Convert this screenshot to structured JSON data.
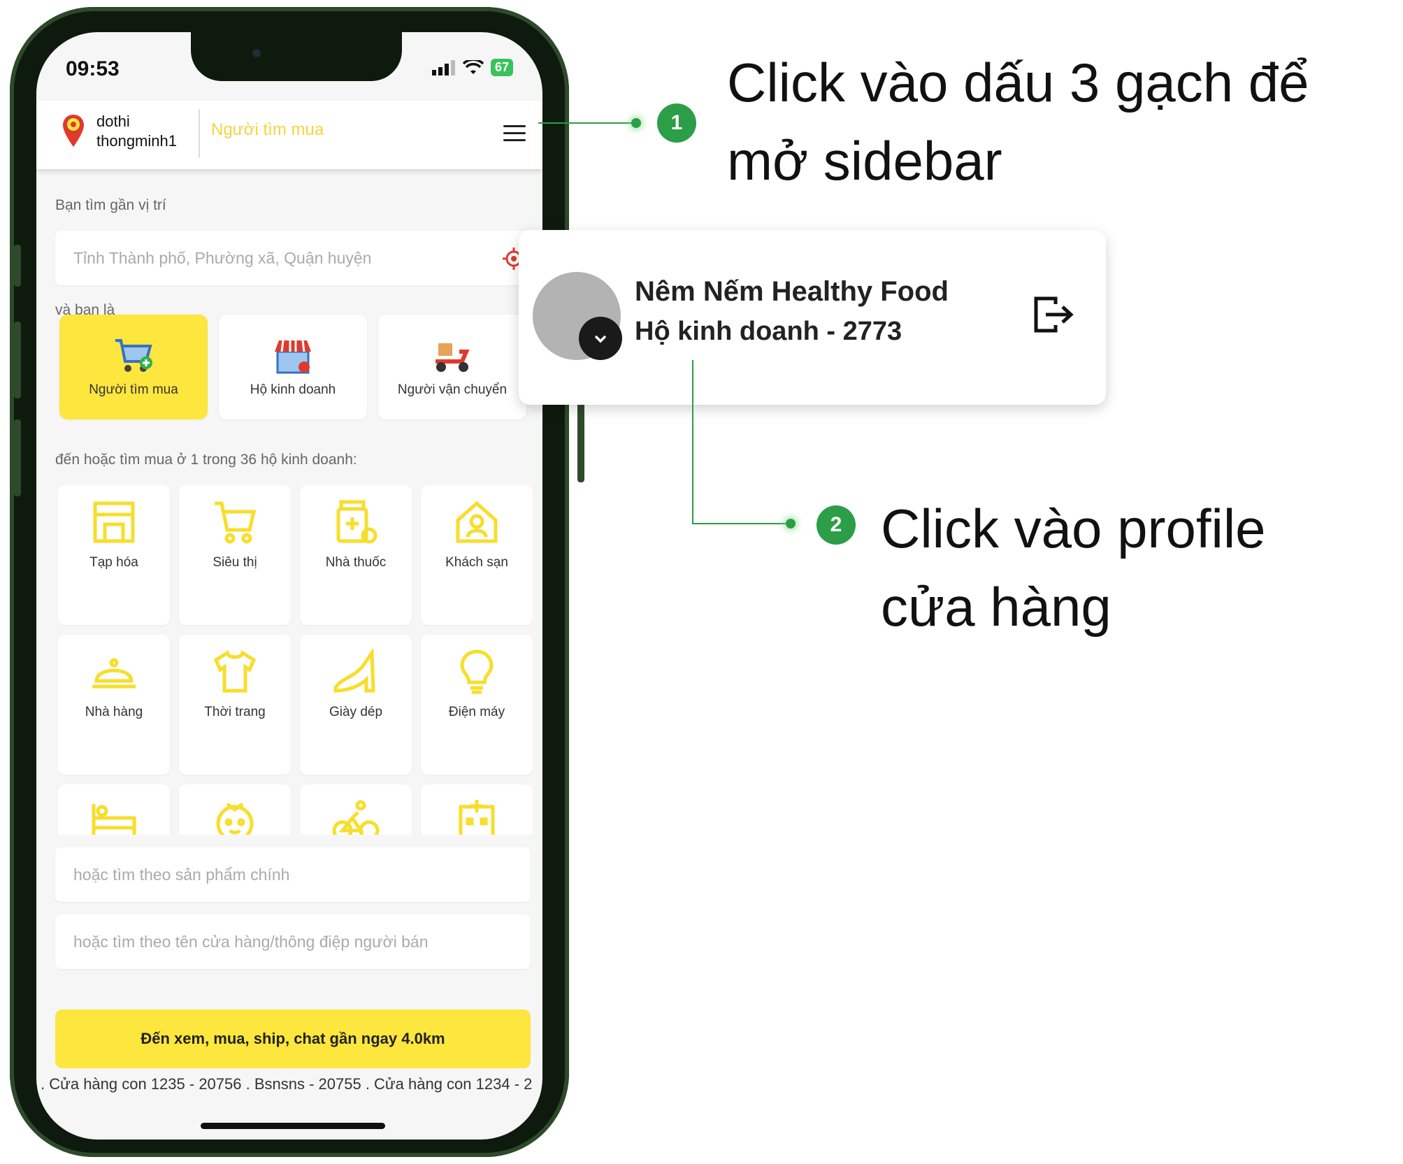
{
  "status_bar": {
    "time": "09:53",
    "battery": "67"
  },
  "header": {
    "brand_line1": "dothi",
    "brand_line2": "thongminh1",
    "role": "Người tìm mua"
  },
  "location": {
    "label": "Bạn tìm gần vị trí",
    "placeholder": "Tỉnh Thành phố, Phường xã, Quận huyện"
  },
  "role_section": {
    "label": "và bạn là",
    "roles": [
      {
        "label": "Người tìm mua",
        "active": true
      },
      {
        "label": "Hộ kinh doanh",
        "active": false
      },
      {
        "label": "Người vận chuyển",
        "active": false
      }
    ]
  },
  "categories_label": "đến hoặc tìm mua ở 1 trong 36 hộ kinh doanh:",
  "categories": [
    {
      "label": "Tạp hóa",
      "icon": "store-icon"
    },
    {
      "label": "Siêu thị",
      "icon": "cart-icon"
    },
    {
      "label": "Nhà thuốc",
      "icon": "pharmacy-icon"
    },
    {
      "label": "Khách sạn",
      "icon": "hotel-icon"
    },
    {
      "label": "Nhà hàng",
      "icon": "cloche-icon"
    },
    {
      "label": "Thời trang",
      "icon": "shirt-icon"
    },
    {
      "label": "Giày dép",
      "icon": "heel-icon"
    },
    {
      "label": "Điện máy",
      "icon": "bulb-icon"
    },
    {
      "label": "",
      "icon": "bed-icon"
    },
    {
      "label": "",
      "icon": "baby-icon"
    },
    {
      "label": "",
      "icon": "bicycle-icon"
    },
    {
      "label": "",
      "icon": "hospital-icon"
    }
  ],
  "search_product_placeholder": "hoặc tìm theo sản phẩm chính",
  "search_store_placeholder": "hoặc tìm theo tên cửa hàng/thông điệp người bán",
  "cta_label": "Đến xem, mua, ship, chat gần ngay 4.0km",
  "ticker": ". Cửa hàng con 1235 - 20756 . Bsnsns - 20755 . Cửa hàng con 1234 - 2",
  "annotations": {
    "step1_number": "1",
    "step1_line1": "Click vào dấu 3 gạch để",
    "step1_line2": "mở sidebar",
    "step2_number": "2",
    "step2_line1": "Click vào profile",
    "step2_line2": "cửa hàng"
  },
  "profile_popup": {
    "name": "Nêm Nếm Healthy Food",
    "subtitle": "Hộ kinh doanh - 2773"
  },
  "colors": {
    "accent_yellow": "#fde63d",
    "annotation_green": "#2b9e47",
    "phone_frame": "#0e1a0e"
  }
}
